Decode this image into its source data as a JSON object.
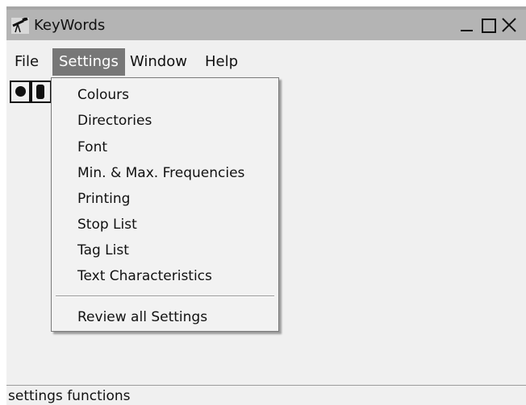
{
  "window": {
    "title": "KeyWords",
    "icon": "telescope-icon",
    "controls": [
      "minimize-icon",
      "maximize-icon",
      "close-icon"
    ]
  },
  "menubar": {
    "items": [
      {
        "label": "File"
      },
      {
        "label": "Settings",
        "active": true
      },
      {
        "label": "Window"
      },
      {
        "label": "Help"
      }
    ]
  },
  "toolbar": {
    "buttons": [
      {
        "icon": "record-icon"
      },
      {
        "icon": "stop-icon"
      }
    ]
  },
  "settings_menu": {
    "items": [
      {
        "label": "Colours"
      },
      {
        "label": "Directories"
      },
      {
        "label": "Font"
      },
      {
        "label": "Min. & Max. Frequencies"
      },
      {
        "label": "Printing"
      },
      {
        "label": "Stop List"
      },
      {
        "label": "Tag List"
      },
      {
        "label": "Text Characteristics"
      }
    ],
    "footer_item": {
      "label": "Review all Settings"
    }
  },
  "statusbar": {
    "text": "settings functions"
  },
  "colors": {
    "titlebar": "#b4b4b4",
    "menu_active_bg": "#777777",
    "menu_active_fg": "#ffffff",
    "background": "#f0f0f0"
  }
}
